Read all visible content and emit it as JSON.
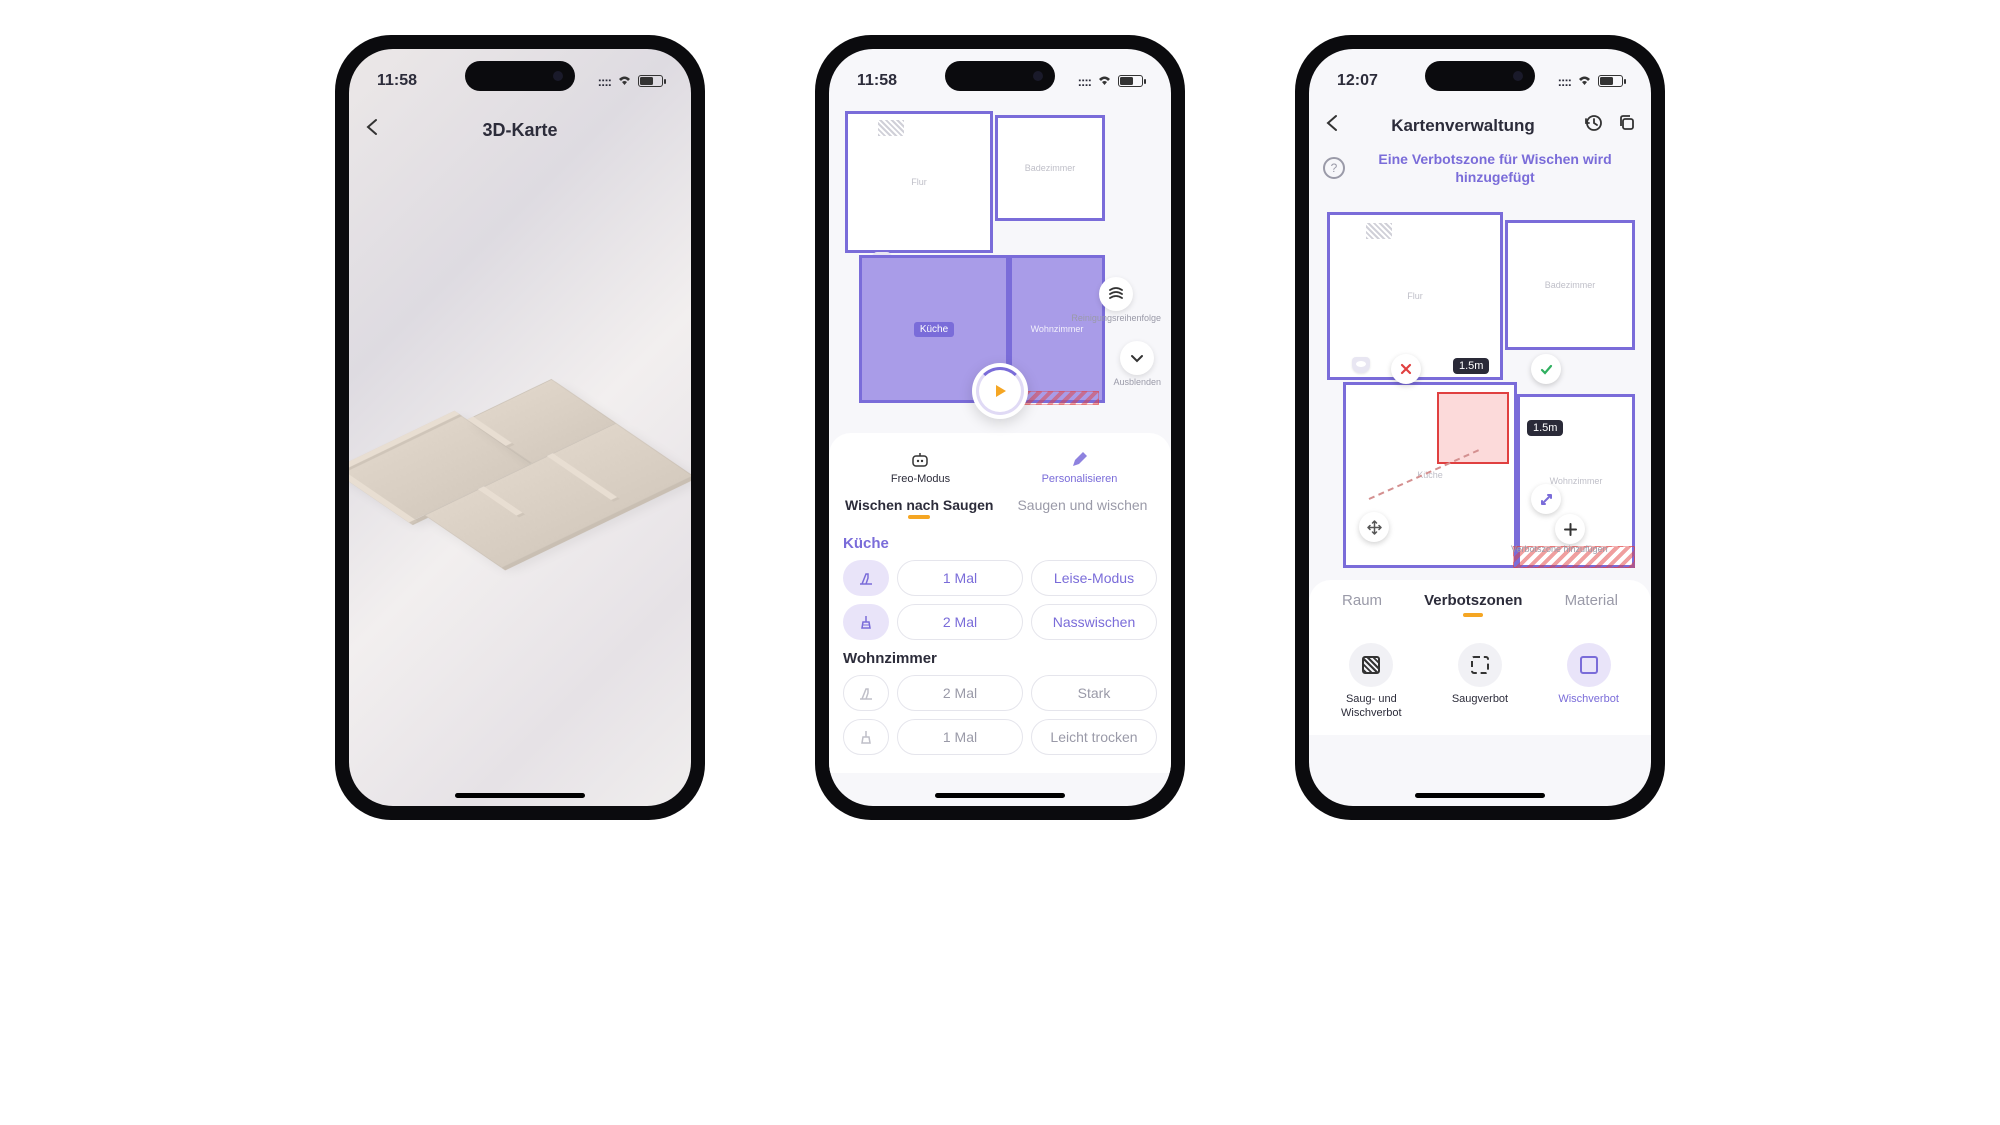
{
  "phone1": {
    "time": "11:58",
    "title": "3D-Karte"
  },
  "phone2": {
    "time": "11:58",
    "rooms": {
      "flur": "Flur",
      "bad": "Badezimmer",
      "kueche": "Küche",
      "wohn": "Wohnzimmer"
    },
    "order_label": "Reinigungsreihenfolge",
    "hide_label": "Ausblenden",
    "mode_freo": "Freo-Modus",
    "mode_pers": "Personalisieren",
    "tab_active": "Wischen nach Saugen",
    "tab_other": "Saugen und wischen",
    "kueche": {
      "title": "Küche",
      "vac_times": "1  Mal",
      "vac_power": "Leise-Modus",
      "mop_times": "2  Mal",
      "mop_power": "Nasswischen"
    },
    "wohn": {
      "title": "Wohnzimmer",
      "vac_times": "2  Mal",
      "vac_power": "Stark",
      "mop_times": "1  Mal",
      "mop_power": "Leicht trocken"
    }
  },
  "phone3": {
    "time": "12:07",
    "title": "Kartenverwaltung",
    "subheading": "Eine Verbotszone für Wischen wird hinzugefügt",
    "rooms": {
      "flur": "Flur",
      "bad": "Badezimmer",
      "kueche": "Küche",
      "wohn": "Wohnzimmer"
    },
    "w": "1.5m",
    "h": "1.5m",
    "add_zone": "Verbotszone hinzufügen",
    "tabs": {
      "raum": "Raum",
      "zonen": "Verbotszonen",
      "material": "Material"
    },
    "types": {
      "both": "Saug- und Wischverbot",
      "vac": "Saugverbot",
      "mop": "Wischverbot"
    }
  }
}
